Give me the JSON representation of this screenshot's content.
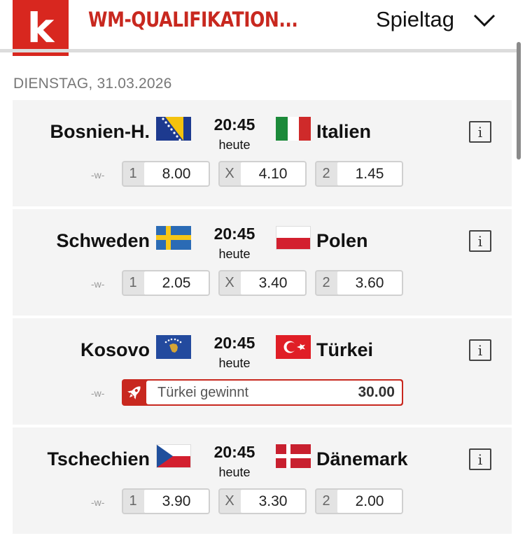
{
  "header": {
    "logo_letter": "k",
    "competition": "WM-QUALIFIKATION...",
    "view_selector": "Spieltag"
  },
  "date_label": "DIENSTAG, 31.03.2026",
  "matches": [
    {
      "home": "Bosnien-H.",
      "home_flag": "bosnia",
      "time": "20:45",
      "day": "heute",
      "away": "Italien",
      "away_flag": "italy",
      "w_label": "-w-",
      "info": "i",
      "odds": [
        {
          "key": "1",
          "value": "8.00"
        },
        {
          "key": "X",
          "value": "4.10"
        },
        {
          "key": "2",
          "value": "1.45"
        }
      ]
    },
    {
      "home": "Schweden",
      "home_flag": "sweden",
      "time": "20:45",
      "day": "heute",
      "away": "Polen",
      "away_flag": "poland",
      "w_label": "-w-",
      "info": "i",
      "odds": [
        {
          "key": "1",
          "value": "2.05"
        },
        {
          "key": "X",
          "value": "3.40"
        },
        {
          "key": "2",
          "value": "3.60"
        }
      ]
    },
    {
      "home": "Kosovo",
      "home_flag": "kosovo",
      "time": "20:45",
      "day": "heute",
      "away": "Türkei",
      "away_flag": "turkey",
      "w_label": "-w-",
      "info": "i",
      "promo": {
        "label": "Türkei gewinnt",
        "value": "30.00",
        "icon": "rocket-icon"
      }
    },
    {
      "home": "Tschechien",
      "home_flag": "czechia",
      "time": "20:45",
      "day": "heute",
      "away": "Dänemark",
      "away_flag": "denmark",
      "w_label": "-w-",
      "info": "i",
      "odds": [
        {
          "key": "1",
          "value": "3.90"
        },
        {
          "key": "X",
          "value": "3.30"
        },
        {
          "key": "2",
          "value": "2.00"
        }
      ]
    }
  ],
  "colors": {
    "brand_red": "#d8271f",
    "title_red": "#c8281f",
    "card_bg": "#f4f4f4",
    "muted_text": "#777777"
  }
}
